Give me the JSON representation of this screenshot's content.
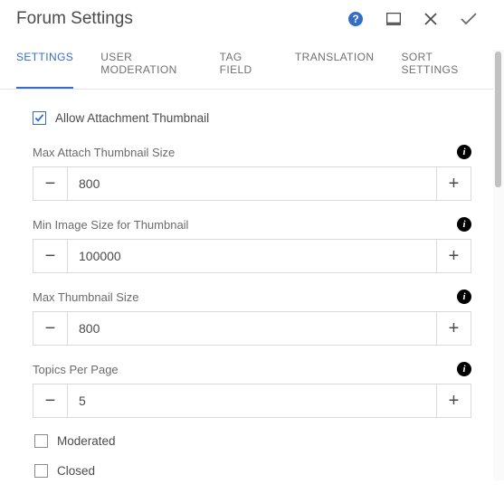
{
  "header": {
    "title": "Forum Settings"
  },
  "tabs": [
    {
      "label": "SETTINGS",
      "active": true
    },
    {
      "label": "USER MODERATION",
      "active": false
    },
    {
      "label": "TAG FIELD",
      "active": false
    },
    {
      "label": "TRANSLATION",
      "active": false
    },
    {
      "label": "SORT SETTINGS",
      "active": false
    }
  ],
  "settings": {
    "allow_thumb": {
      "label": "Allow Attachment Thumbnail",
      "checked": true
    },
    "max_attach_thumb": {
      "label": "Max Attach Thumbnail Size",
      "value": "800"
    },
    "min_image_thumb": {
      "label": "Min Image Size for Thumbnail",
      "value": "100000"
    },
    "max_thumb": {
      "label": "Max Thumbnail Size",
      "value": "800"
    },
    "topics_per_page": {
      "label": "Topics Per Page",
      "value": "5"
    },
    "moderated": {
      "label": "Moderated",
      "checked": false
    },
    "closed": {
      "label": "Closed",
      "checked": false
    }
  }
}
